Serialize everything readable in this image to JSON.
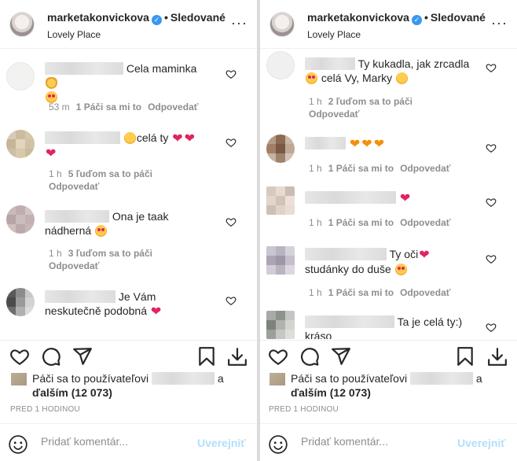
{
  "left": {
    "header": {
      "username": "marketakonvickova",
      "dot": "•",
      "follow": "Sledované",
      "location": "Lovely Place"
    },
    "comments": [
      {
        "text_before": "",
        "text": "Cela maminka",
        "meta_time": "53 m",
        "meta_likes": "1 Páči sa mi to",
        "meta_reply": "Odpovedať"
      },
      {
        "text": "celá ty",
        "meta_time": "1 h",
        "meta_likes": "5 ľuďom sa to páči",
        "meta_reply": "Odpovedať"
      },
      {
        "text": "Ona je taak nádherná",
        "meta_time": "1 h",
        "meta_likes": "3 ľuďom sa to páči",
        "meta_reply": "Odpovedať"
      },
      {
        "text": "Je Vám neskutečně podobná",
        "meta_time": "",
        "meta_likes": "",
        "meta_reply": ""
      }
    ],
    "likes": {
      "prefix": "Páči sa to používateľovi",
      "conj": "a",
      "others": "ďalším (12 073)"
    },
    "time": "PRED 1 HODINOU",
    "add_comment": {
      "placeholder": "Pridať komentár...",
      "post": "Uverejniť"
    }
  },
  "right": {
    "header": {
      "username": "marketakonvickova",
      "dot": "•",
      "follow": "Sledované",
      "location": "Lovely Place"
    },
    "comments": [
      {
        "text": "Ty kukadla, jak zrcadla",
        "text2": "celá Vy, Marky",
        "meta_time": "1 h",
        "meta_likes": "2 ľuďom sa to páči",
        "meta_reply": "Odpovedať"
      },
      {
        "text": "",
        "meta_time": "1 h",
        "meta_likes": "1 Páči sa mi to",
        "meta_reply": "Odpovedať"
      },
      {
        "text": "",
        "meta_time": "1 h",
        "meta_likes": "1 Páči sa mi to",
        "meta_reply": "Odpovedať"
      },
      {
        "text": "Ty oči",
        "text2": "studánky do duše",
        "meta_time": "1 h",
        "meta_likes": "1 Páči sa mi to",
        "meta_reply": "Odpovedať"
      },
      {
        "text": "Ta je celá ty:)",
        "text2": "kráso"
      }
    ],
    "likes": {
      "prefix": "Páči sa to používateľovi",
      "conj": "a",
      "others": "ďalším (12 073)"
    },
    "time": "PRED 1 HODINOU",
    "add_comment": {
      "placeholder": "Pridať komentár...",
      "post": "Uverejniť"
    }
  },
  "colors": {
    "verified": "#3897f0",
    "heart": "#e0245e",
    "post_disabled": "#b2dffc",
    "meta": "#8e8e8e"
  },
  "icons": [
    "verified-icon",
    "more-icon",
    "heart-icon",
    "comment-icon",
    "share-icon",
    "bookmark-icon",
    "download-icon",
    "smile-icon"
  ]
}
